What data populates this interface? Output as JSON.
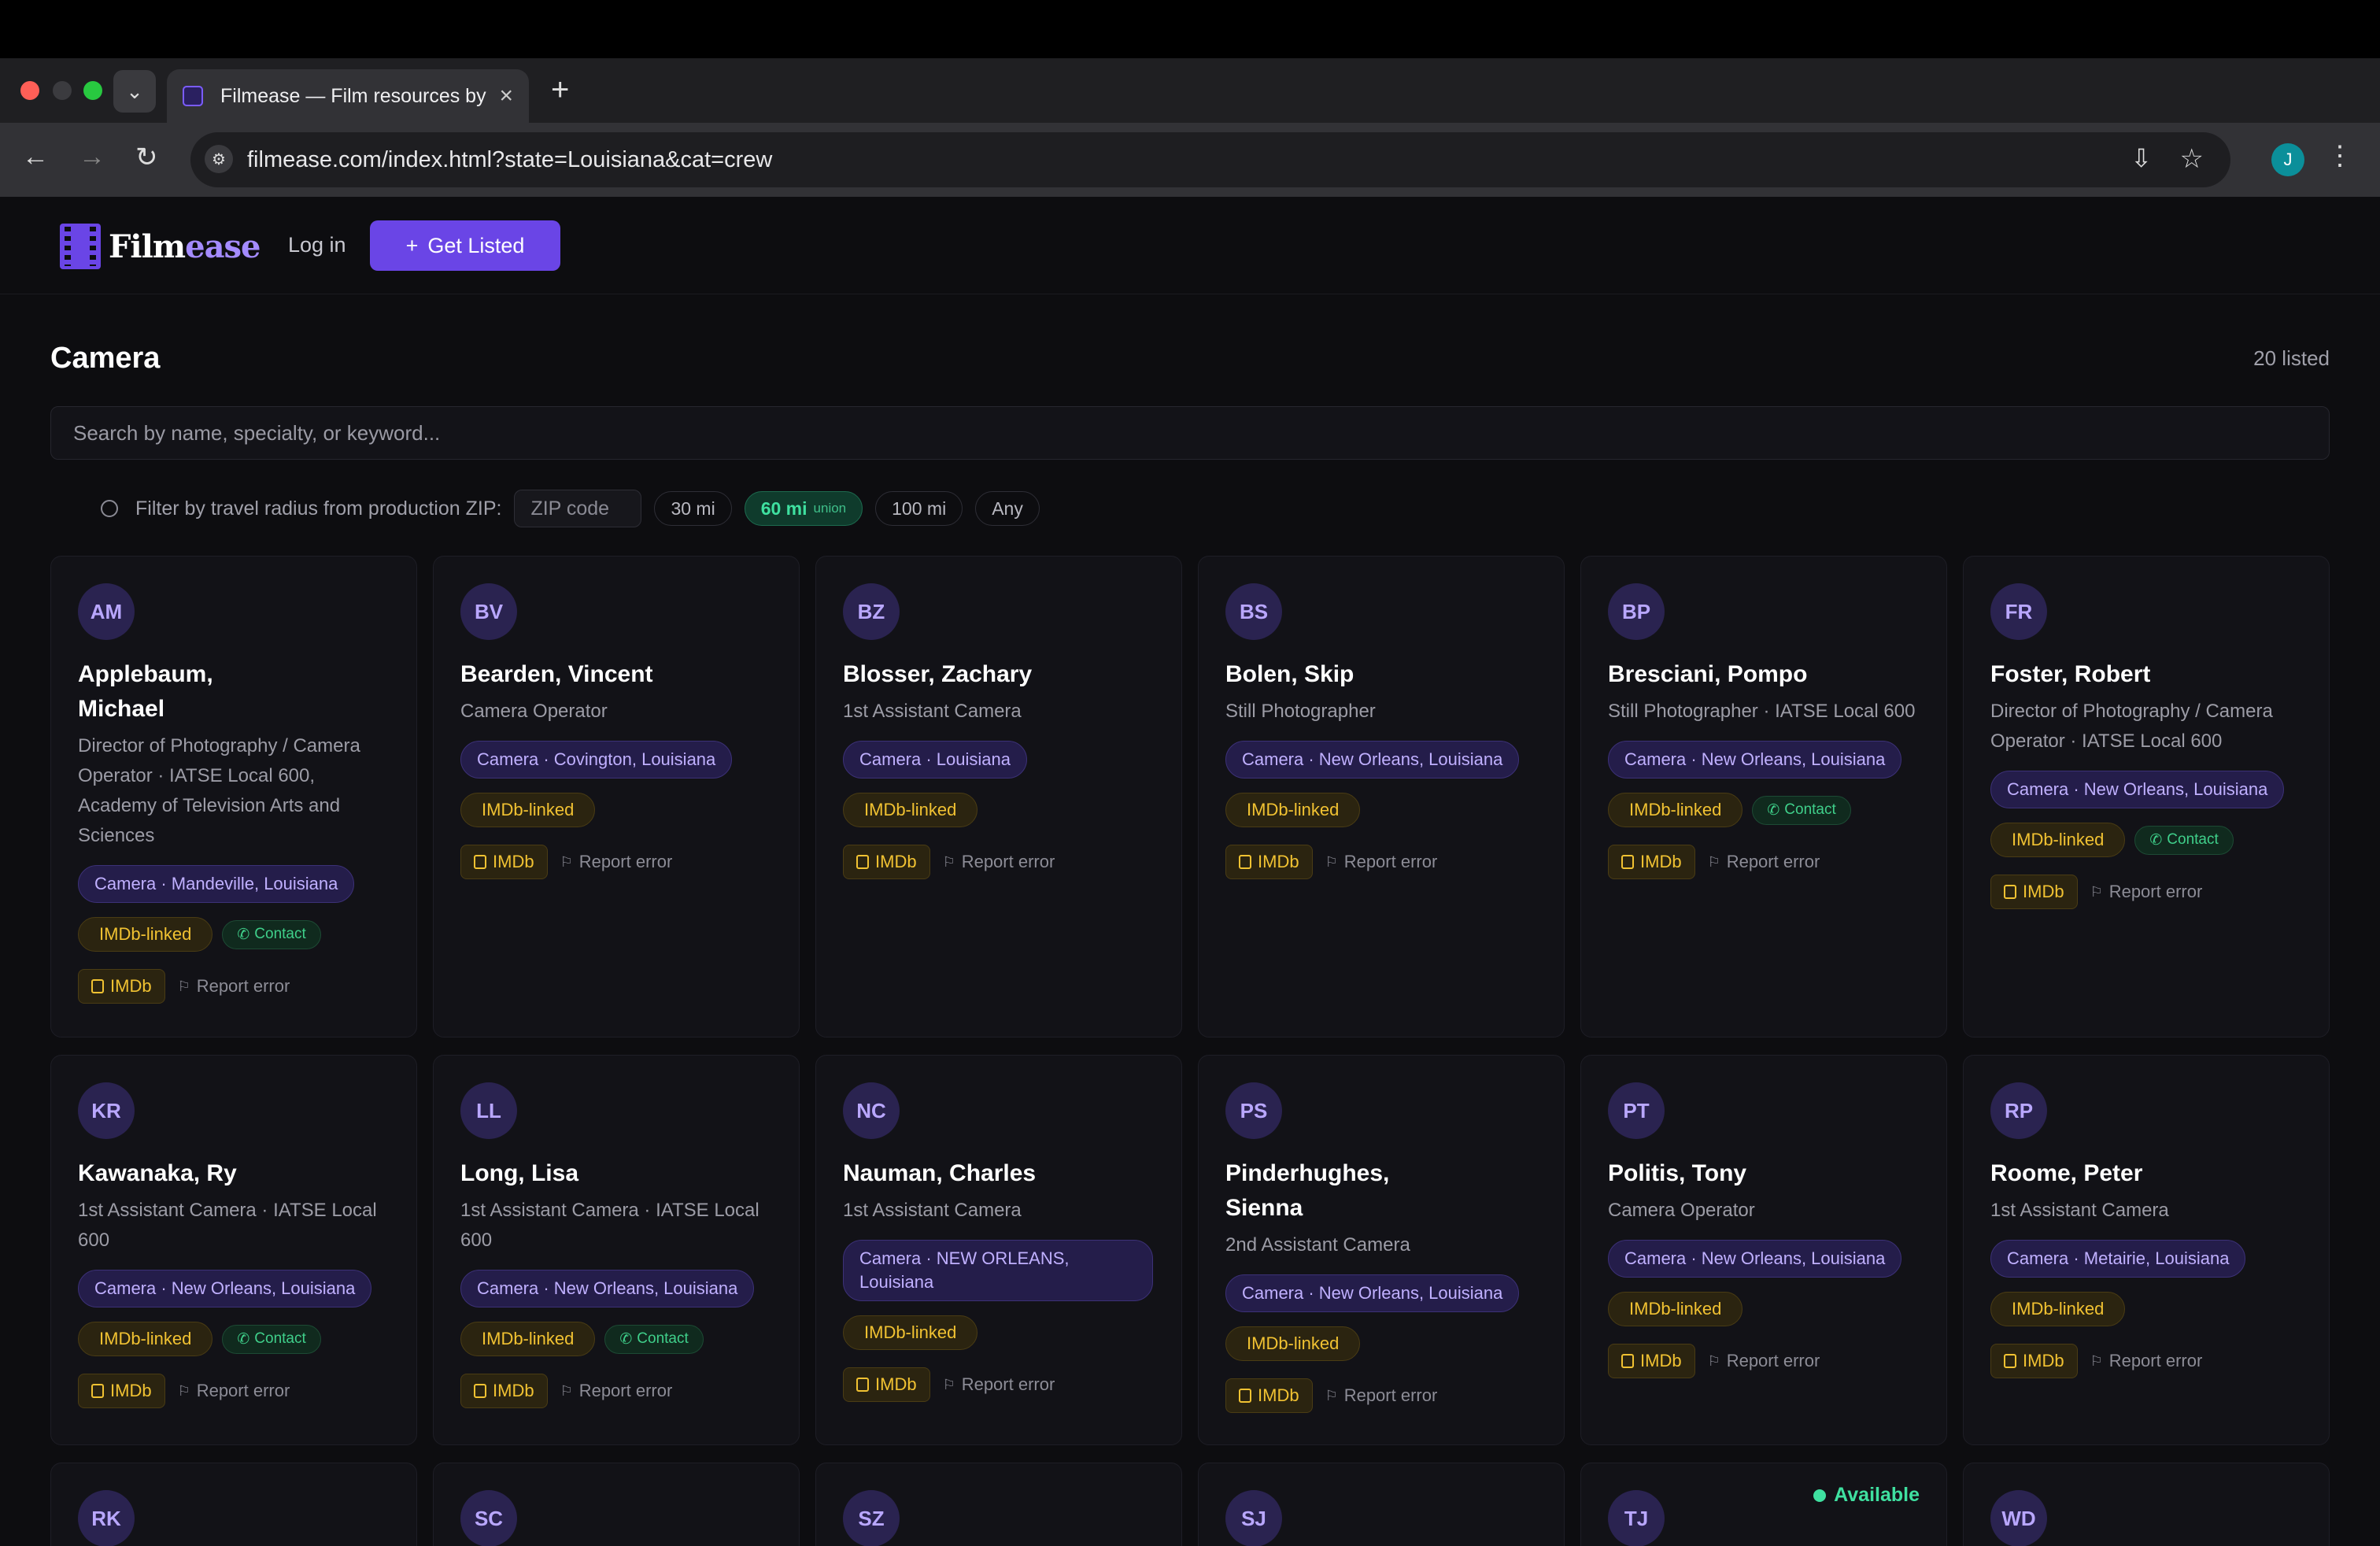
{
  "browser": {
    "tab_title": "Filmease — Film resources by",
    "url": "filmease.com/index.html?state=Louisiana&cat=crew",
    "profile_initial": "J"
  },
  "site": {
    "logo_main": "Film",
    "logo_accent": "ease",
    "login": "Log in",
    "get_listed": "Get Listed"
  },
  "section": {
    "title": "Camera",
    "count": "20 listed"
  },
  "search": {
    "placeholder": "Search by name, specialty, or keyword..."
  },
  "filter": {
    "label": "Filter by travel radius from production ZIP:",
    "zip_placeholder": "ZIP code",
    "chips": [
      {
        "label": "30 mi",
        "sub": ""
      },
      {
        "label": "60 mi",
        "sub": "union"
      },
      {
        "label": "100 mi",
        "sub": ""
      },
      {
        "label": "Any",
        "sub": ""
      }
    ]
  },
  "labels": {
    "imdb_linked": "IMDb-linked",
    "contact": "Contact",
    "imdb": "IMDb",
    "report": "Report error",
    "available": "Available"
  },
  "cards": [
    {
      "initials": "AM",
      "name_line1": "Applebaum,",
      "name_line2": "Michael",
      "role": "Director of Photography / Camera Operator · IATSE Local 600, Academy of Television Arts and Sciences",
      "location": "Camera · Mandeville, Louisiana"
    },
    {
      "initials": "BV",
      "name_line1": "Bearden, Vincent",
      "name_line2": "",
      "role": "Camera Operator",
      "location": "Camera · Covington, Louisiana"
    },
    {
      "initials": "BZ",
      "name_line1": "Blosser, Zachary",
      "name_line2": "",
      "role": "1st Assistant Camera",
      "location": "Camera · Louisiana"
    },
    {
      "initials": "BS",
      "name_line1": "Bolen, Skip",
      "name_line2": "",
      "role": "Still Photographer",
      "location": "Camera · New Orleans, Louisiana"
    },
    {
      "initials": "BP",
      "name_line1": "Bresciani, Pompo",
      "name_line2": "",
      "role": "Still Photographer · IATSE Local 600",
      "location": "Camera · New Orleans, Louisiana"
    },
    {
      "initials": "FR",
      "name_line1": "Foster, Robert",
      "name_line2": "",
      "role": "Director of Photography / Camera Operator · IATSE Local 600",
      "location": "Camera · New Orleans, Louisiana"
    },
    {
      "initials": "KR",
      "name_line1": "Kawanaka, Ry",
      "name_line2": "",
      "role": "1st Assistant Camera · IATSE Local 600",
      "location": "Camera · New Orleans, Louisiana"
    },
    {
      "initials": "LL",
      "name_line1": "Long, Lisa",
      "name_line2": "",
      "role": "1st Assistant Camera · IATSE Local 600",
      "location": "Camera · New Orleans, Louisiana"
    },
    {
      "initials": "NC",
      "name_line1": "Nauman, Charles",
      "name_line2": "",
      "role": "1st Assistant Camera",
      "location": "Camera · NEW ORLEANS, Louisiana"
    },
    {
      "initials": "PS",
      "name_line1": "Pinderhughes,",
      "name_line2": "Sienna",
      "role": "2nd Assistant Camera",
      "location": "Camera · New Orleans, Louisiana"
    },
    {
      "initials": "PT",
      "name_line1": "Politis, Tony",
      "name_line2": "",
      "role": "Camera Operator",
      "location": "Camera · New Orleans, Louisiana"
    },
    {
      "initials": "RP",
      "name_line1": "Roome, Peter",
      "name_line2": "",
      "role": "1st Assistant Camera",
      "location": "Camera · Metairie, Louisiana"
    },
    {
      "initials": "RK"
    },
    {
      "initials": "SC"
    },
    {
      "initials": "SZ"
    },
    {
      "initials": "SJ"
    },
    {
      "initials": "TJ"
    },
    {
      "initials": "WD"
    }
  ]
}
